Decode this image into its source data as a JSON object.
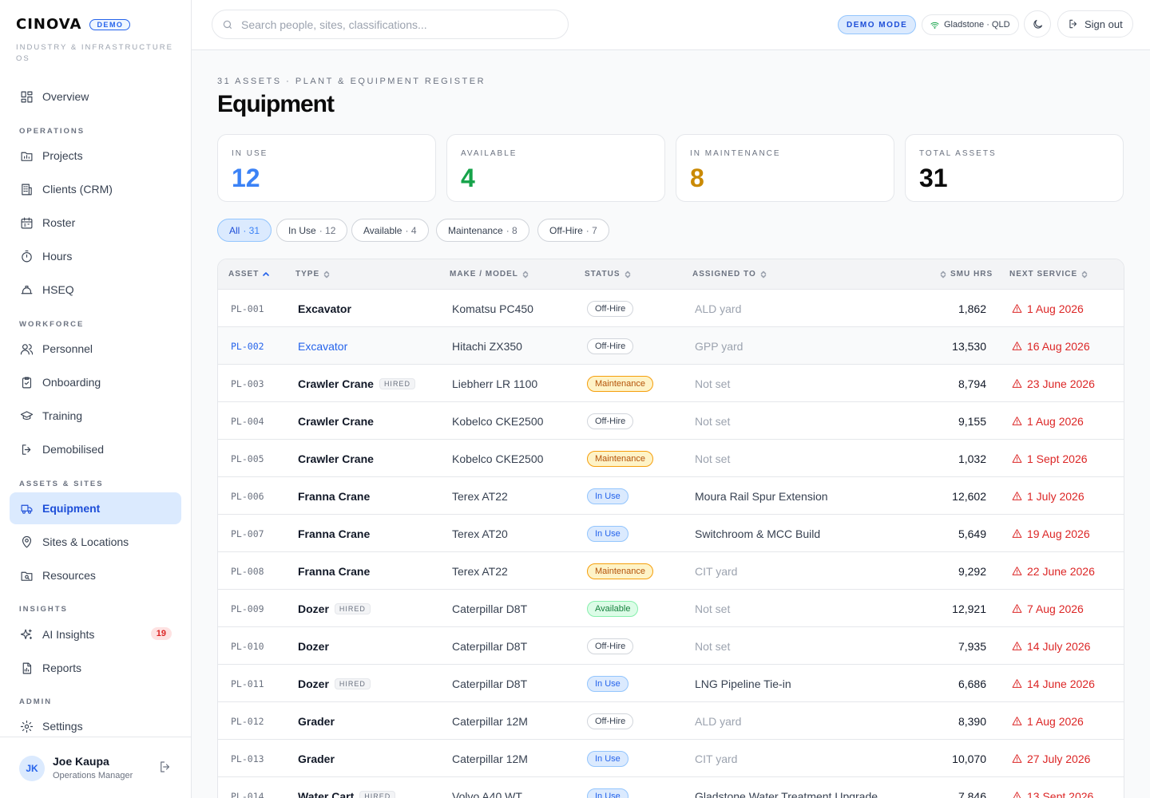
{
  "brand": {
    "logo": "CINOVA",
    "badge": "DEMO",
    "subtitle": "INDUSTRY & INFRASTRUCTURE OS"
  },
  "sidebar": {
    "overview": "Overview",
    "sections": {
      "operations": "OPERATIONS",
      "workforce": "WORKFORCE",
      "assets": "ASSETS & SITES",
      "insights": "INSIGHTS",
      "admin": "ADMIN"
    },
    "items": {
      "projects": "Projects",
      "clients": "Clients (CRM)",
      "roster": "Roster",
      "hours": "Hours",
      "hseq": "HSEQ",
      "personnel": "Personnel",
      "onboarding": "Onboarding",
      "training": "Training",
      "demobilised": "Demobilised",
      "equipment": "Equipment",
      "sites": "Sites & Locations",
      "resources": "Resources",
      "ai_insights": "AI Insights",
      "ai_insights_badge": "19",
      "reports": "Reports",
      "settings": "Settings"
    },
    "user": {
      "initials": "JK",
      "name": "Joe Kaupa",
      "role": "Operations Manager"
    }
  },
  "topbar": {
    "search_placeholder": "Search people, sites, classifications...",
    "demo_mode": "DEMO MODE",
    "location": "Gladstone · QLD",
    "sign_out": "Sign out"
  },
  "page": {
    "eyebrow": "31 ASSETS · PLANT & EQUIPMENT REGISTER",
    "title": "Equipment"
  },
  "stats": [
    {
      "label": "IN USE",
      "value": "12",
      "color": "#3b82f6"
    },
    {
      "label": "AVAILABLE",
      "value": "4",
      "color": "#16a34a"
    },
    {
      "label": "IN MAINTENANCE",
      "value": "8",
      "color": "#ca8a04"
    },
    {
      "label": "TOTAL ASSETS",
      "value": "31",
      "color": "#0b0b0b"
    }
  ],
  "filters": [
    {
      "label": "All",
      "count": "· 31"
    },
    {
      "label": "In Use",
      "count": "· 12"
    },
    {
      "label": "Available",
      "count": "· 4"
    },
    {
      "label": "Maintenance",
      "count": "· 8"
    },
    {
      "label": "Off-Hire",
      "count": "· 7"
    }
  ],
  "table": {
    "headers": {
      "asset": "ASSET",
      "type": "TYPE",
      "make": "MAKE / MODEL",
      "status": "STATUS",
      "assigned": "ASSIGNED TO",
      "smu": "SMU HRS",
      "next_service": "NEXT SERVICE"
    },
    "hired_label": "HIRED",
    "rows": [
      {
        "id": "PL-001",
        "type": "Excavator",
        "hired": false,
        "make": "Komatsu PC450",
        "status": "Off-Hire",
        "assigned": "ALD yard",
        "smu": "1,862",
        "service": "1 Aug 2026"
      },
      {
        "id": "PL-002",
        "type": "Excavator",
        "hired": false,
        "make": "Hitachi ZX350",
        "status": "Off-Hire",
        "assigned": "GPP yard",
        "smu": "13,530",
        "service": "16 Aug 2026"
      },
      {
        "id": "PL-003",
        "type": "Crawler Crane",
        "hired": true,
        "make": "Liebherr LR 1100",
        "status": "Maintenance",
        "assigned": "Not set",
        "smu": "8,794",
        "service": "23 June 2026"
      },
      {
        "id": "PL-004",
        "type": "Crawler Crane",
        "hired": false,
        "make": "Kobelco CKE2500",
        "status": "Off-Hire",
        "assigned": "Not set",
        "smu": "9,155",
        "service": "1 Aug 2026"
      },
      {
        "id": "PL-005",
        "type": "Crawler Crane",
        "hired": false,
        "make": "Kobelco CKE2500",
        "status": "Maintenance",
        "assigned": "Not set",
        "smu": "1,032",
        "service": "1 Sept 2026"
      },
      {
        "id": "PL-006",
        "type": "Franna Crane",
        "hired": false,
        "make": "Terex AT22",
        "status": "In Use",
        "assigned": "Moura Rail Spur Extension",
        "smu": "12,602",
        "service": "1 July 2026"
      },
      {
        "id": "PL-007",
        "type": "Franna Crane",
        "hired": false,
        "make": "Terex AT20",
        "status": "In Use",
        "assigned": "Switchroom & MCC Build",
        "smu": "5,649",
        "service": "19 Aug 2026"
      },
      {
        "id": "PL-008",
        "type": "Franna Crane",
        "hired": false,
        "make": "Terex AT22",
        "status": "Maintenance",
        "assigned": "CIT yard",
        "smu": "9,292",
        "service": "22 June 2026"
      },
      {
        "id": "PL-009",
        "type": "Dozer",
        "hired": true,
        "make": "Caterpillar D8T",
        "status": "Available",
        "assigned": "Not set",
        "smu": "12,921",
        "service": "7 Aug 2026"
      },
      {
        "id": "PL-010",
        "type": "Dozer",
        "hired": false,
        "make": "Caterpillar D8T",
        "status": "Off-Hire",
        "assigned": "Not set",
        "smu": "7,935",
        "service": "14 July 2026"
      },
      {
        "id": "PL-011",
        "type": "Dozer",
        "hired": true,
        "make": "Caterpillar D8T",
        "status": "In Use",
        "assigned": "LNG Pipeline Tie-in",
        "smu": "6,686",
        "service": "14 June 2026"
      },
      {
        "id": "PL-012",
        "type": "Grader",
        "hired": false,
        "make": "Caterpillar 12M",
        "status": "Off-Hire",
        "assigned": "ALD yard",
        "smu": "8,390",
        "service": "1 Aug 2026"
      },
      {
        "id": "PL-013",
        "type": "Grader",
        "hired": false,
        "make": "Caterpillar 12M",
        "status": "In Use",
        "assigned": "CIT yard",
        "smu": "10,070",
        "service": "27 July 2026"
      },
      {
        "id": "PL-014",
        "type": "Water Cart",
        "hired": true,
        "make": "Volvo A40 WT",
        "status": "In Use",
        "assigned": "Gladstone Water Treatment Upgrade",
        "smu": "7,846",
        "service": "13 Sept 2026"
      }
    ]
  }
}
